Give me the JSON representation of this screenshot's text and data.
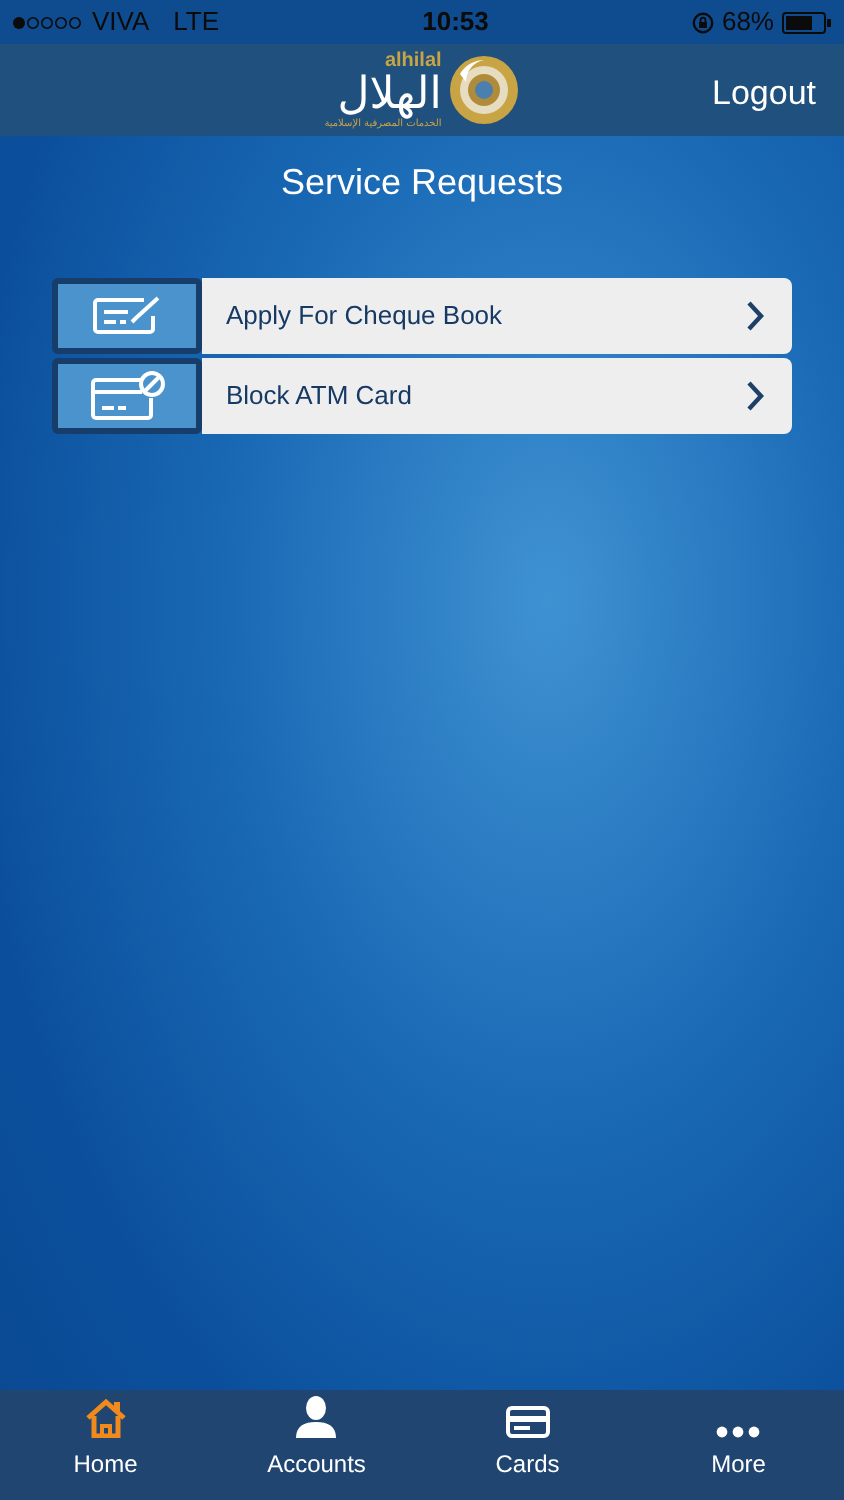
{
  "status_bar": {
    "carrier": "VIVA",
    "network": "LTE",
    "time": "10:53",
    "battery": "68%"
  },
  "header": {
    "logo_latin": "alhilal",
    "logo_arabic": "الهلال",
    "logo_tagline": "الخدمات المصرفية الإسلامية",
    "logout": "Logout"
  },
  "title": "Service Requests",
  "requests": [
    {
      "kind": "cheque",
      "label": "Apply For Cheque Book"
    },
    {
      "kind": "card",
      "label": "Block ATM Card"
    }
  ],
  "tab_bar": [
    {
      "kind": "home",
      "label": "Home",
      "selected": true
    },
    {
      "kind": "accounts",
      "label": "Accounts",
      "selected": false
    },
    {
      "kind": "cards",
      "label": "Cards",
      "selected": false
    },
    {
      "kind": "more",
      "label": "More",
      "selected": false
    }
  ]
}
